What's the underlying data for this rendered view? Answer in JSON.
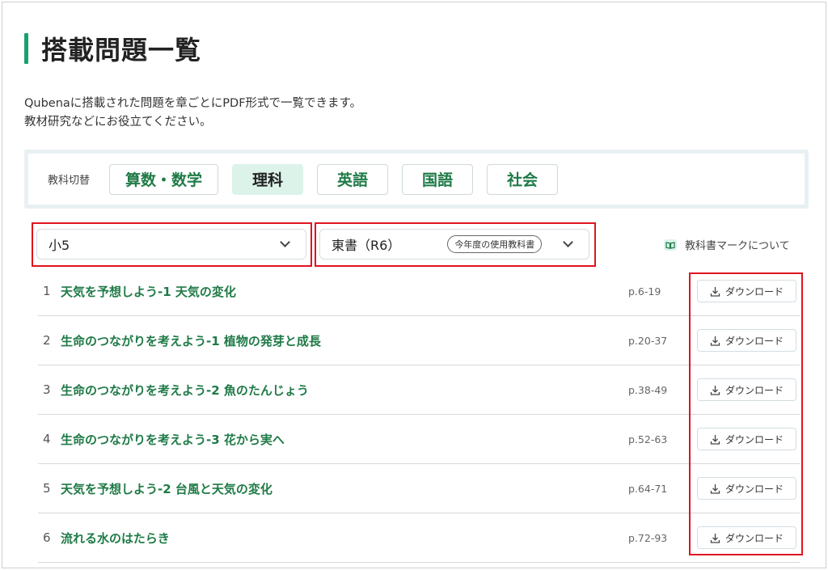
{
  "page": {
    "title": "搭載問題一覧",
    "desc_line1": "Qubenaに搭載された問題を章ごとにPDF形式で一覧できます。",
    "desc_line2": "教材研究などにお役立てください。"
  },
  "subjects": {
    "label": "教科切替",
    "items": [
      {
        "label": "算数・数学",
        "active": false
      },
      {
        "label": "理科",
        "active": true
      },
      {
        "label": "英語",
        "active": false
      },
      {
        "label": "国語",
        "active": false
      },
      {
        "label": "社会",
        "active": false
      }
    ]
  },
  "filters": {
    "grade": "小5",
    "textbook": "東書（R6）",
    "textbook_badge": "今年度の使用教科書",
    "mark_link": "教科書マークについて"
  },
  "chapters": [
    {
      "num": "1",
      "title": "天気を予想しよう-1 天気の変化",
      "pages": "p.6-19",
      "button": "ダウンロード"
    },
    {
      "num": "2",
      "title": "生命のつながりを考えよう-1 植物の発芽と成長",
      "pages": "p.20-37",
      "button": "ダウンロード"
    },
    {
      "num": "3",
      "title": "生命のつながりを考えよう-2 魚のたんじょう",
      "pages": "p.38-49",
      "button": "ダウンロード"
    },
    {
      "num": "4",
      "title": "生命のつながりを考えよう-3 花から実へ",
      "pages": "p.52-63",
      "button": "ダウンロード"
    },
    {
      "num": "5",
      "title": "天気を予想しよう-2 台風と天気の変化",
      "pages": "p.64-71",
      "button": "ダウンロード"
    },
    {
      "num": "6",
      "title": "流れる水のはたらき",
      "pages": "p.72-93",
      "button": "ダウンロード"
    }
  ],
  "colors": {
    "accent": "#1aa06d",
    "link": "#1f7a47",
    "highlight": "#e0141e"
  }
}
